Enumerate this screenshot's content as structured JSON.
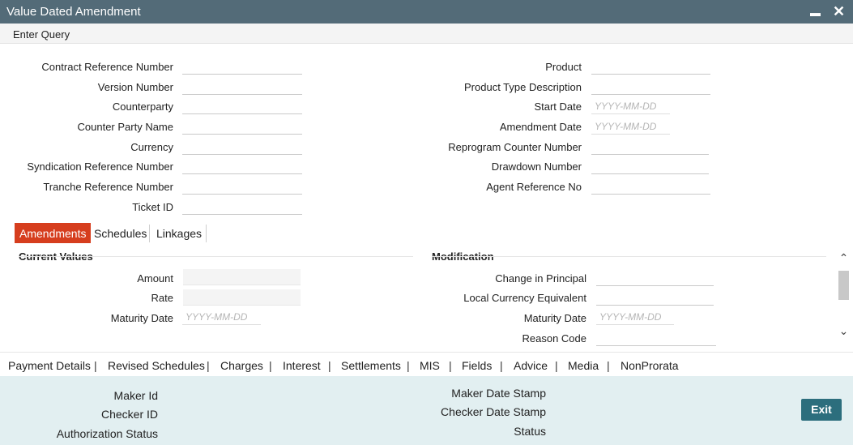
{
  "window": {
    "title": "Value Dated Amendment",
    "minimize_glyph": "▬",
    "close_glyph": "✕"
  },
  "toolbar": {
    "enter_query": "Enter Query"
  },
  "header_fields": {
    "contract_reference_number": "Contract Reference Number",
    "version_number": "Version Number",
    "counterparty": "Counterparty",
    "counter_party_name": "Counter Party Name",
    "currency": "Currency",
    "syndication_reference_number": "Syndication Reference Number",
    "tranche_reference_number": "Tranche Reference Number",
    "ticket_id": "Ticket ID",
    "product": "Product",
    "product_type_description": "Product Type Description",
    "start_date": "Start Date",
    "amendment_date": "Amendment Date",
    "reprogram_counter_number": "Reprogram Counter Number",
    "drawdown_number": "Drawdown Number",
    "agent_reference_no": "Agent Reference No"
  },
  "date_placeholder": "YYYY-MM-DD",
  "tabs": [
    "Amendments",
    "Schedules",
    "Linkages"
  ],
  "current_values": {
    "title": "Current Values",
    "amount": "Amount",
    "rate": "Rate",
    "maturity_date": "Maturity Date"
  },
  "modification": {
    "title": "Modification",
    "change_in_principal": "Change in Principal",
    "local_currency_equivalent": "Local Currency Equivalent",
    "maturity_date": "Maturity Date",
    "reason_code": "Reason Code"
  },
  "bottom_links": [
    "Payment Details",
    "Revised Schedules",
    "Charges",
    "Interest",
    "Settlements",
    "MIS",
    "Fields",
    "Advice",
    "Media",
    "NonProrata"
  ],
  "separator": "|",
  "footer": {
    "maker_id": "Maker Id",
    "checker_id": "Checker ID",
    "authorization_status": "Authorization Status",
    "maker_date_stamp": "Maker Date Stamp",
    "checker_date_stamp": "Checker Date Stamp",
    "status": "Status",
    "exit_label": "Exit"
  },
  "colors": {
    "titlebar": "#536b78",
    "active_tab": "#d63e1e",
    "footer_bg": "#e2eff1",
    "exit_button": "#2c6e7d"
  }
}
